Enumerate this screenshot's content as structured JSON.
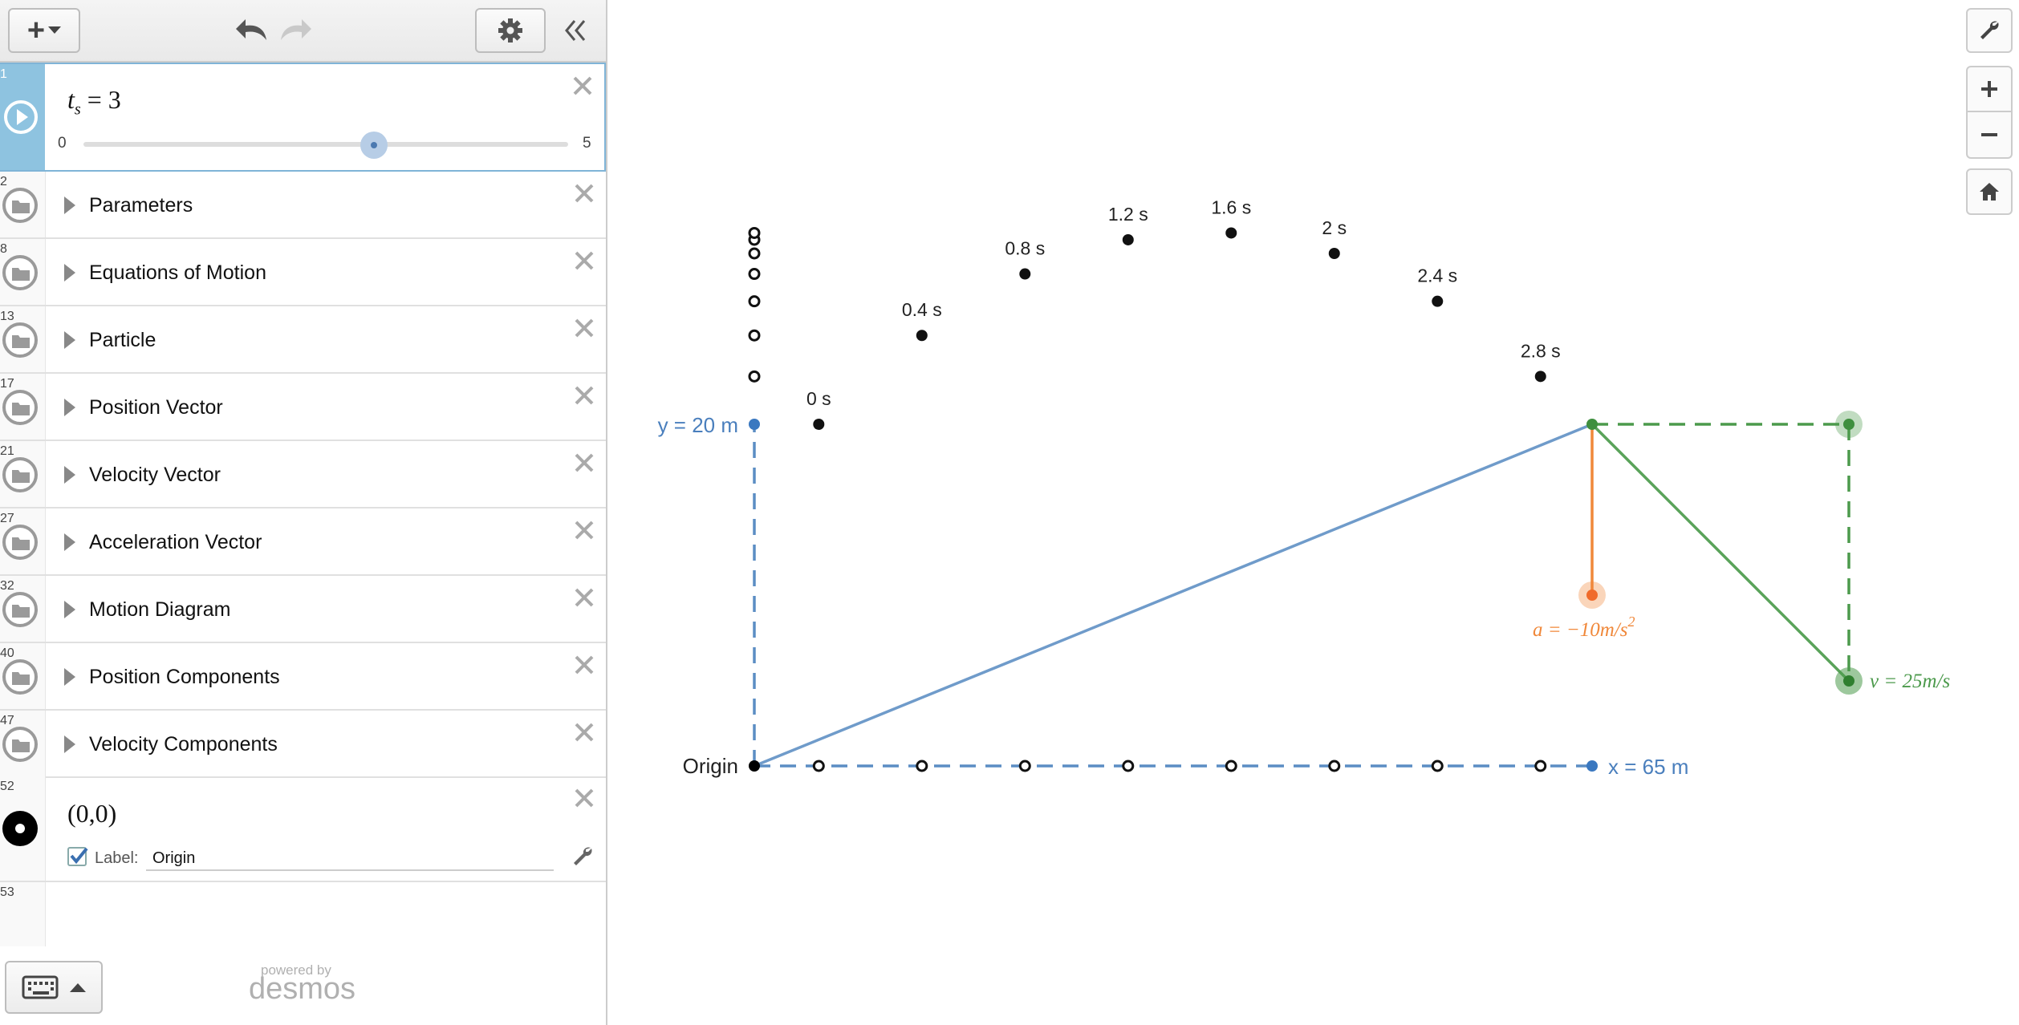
{
  "toolbar": {
    "add_label": "+",
    "add_icon": "plus-icon",
    "undo_icon": "undo-icon",
    "redo_icon": "redo-icon",
    "settings_icon": "gear-icon",
    "collapse_icon": "double-chevron-left-icon"
  },
  "slider_row": {
    "number": "1",
    "var": "t",
    "sub": "s",
    "eq": "= 3",
    "value": 3,
    "min_label": "0",
    "max_label": "5",
    "min": 0,
    "max": 5
  },
  "folders": [
    {
      "number": "2",
      "label": "Parameters"
    },
    {
      "number": "8",
      "label": "Equations of Motion"
    },
    {
      "number": "13",
      "label": "Particle"
    },
    {
      "number": "17",
      "label": "Position Vector"
    },
    {
      "number": "21",
      "label": "Velocity Vector"
    },
    {
      "number": "27",
      "label": "Acceleration Vector"
    },
    {
      "number": "32",
      "label": "Motion Diagram"
    },
    {
      "number": "40",
      "label": "Position Components"
    },
    {
      "number": "47",
      "label": "Velocity Components"
    }
  ],
  "point_row": {
    "number": "52",
    "expression": "(0,0)",
    "label_caption": "Label:",
    "label_checked": true,
    "label_value": "Origin"
  },
  "empty_row": {
    "number": "53"
  },
  "footer": {
    "powered_by": "powered by",
    "brand": "desmos",
    "keyboard_icon": "keyboard-icon"
  },
  "graph": {
    "time_labels": [
      "0 s",
      "0.4 s",
      "0.8 s",
      "1.2 s",
      "1.6 s",
      "2 s",
      "2.4 s",
      "2.8 s"
    ],
    "origin_label": "Origin",
    "y_label": "y = 20 m",
    "x_label": "x = 65 m",
    "accel_label": "a = −10m/s",
    "accel_exp": "2",
    "vel_label": "v = 25m/s",
    "colors": {
      "blue": "#5b8dc4",
      "green": "#4c9a4c",
      "orange": "#f0883a"
    }
  },
  "right_tools": [
    "wrench-icon",
    "zoom-in-icon",
    "zoom-out-icon",
    "home-icon"
  ]
}
